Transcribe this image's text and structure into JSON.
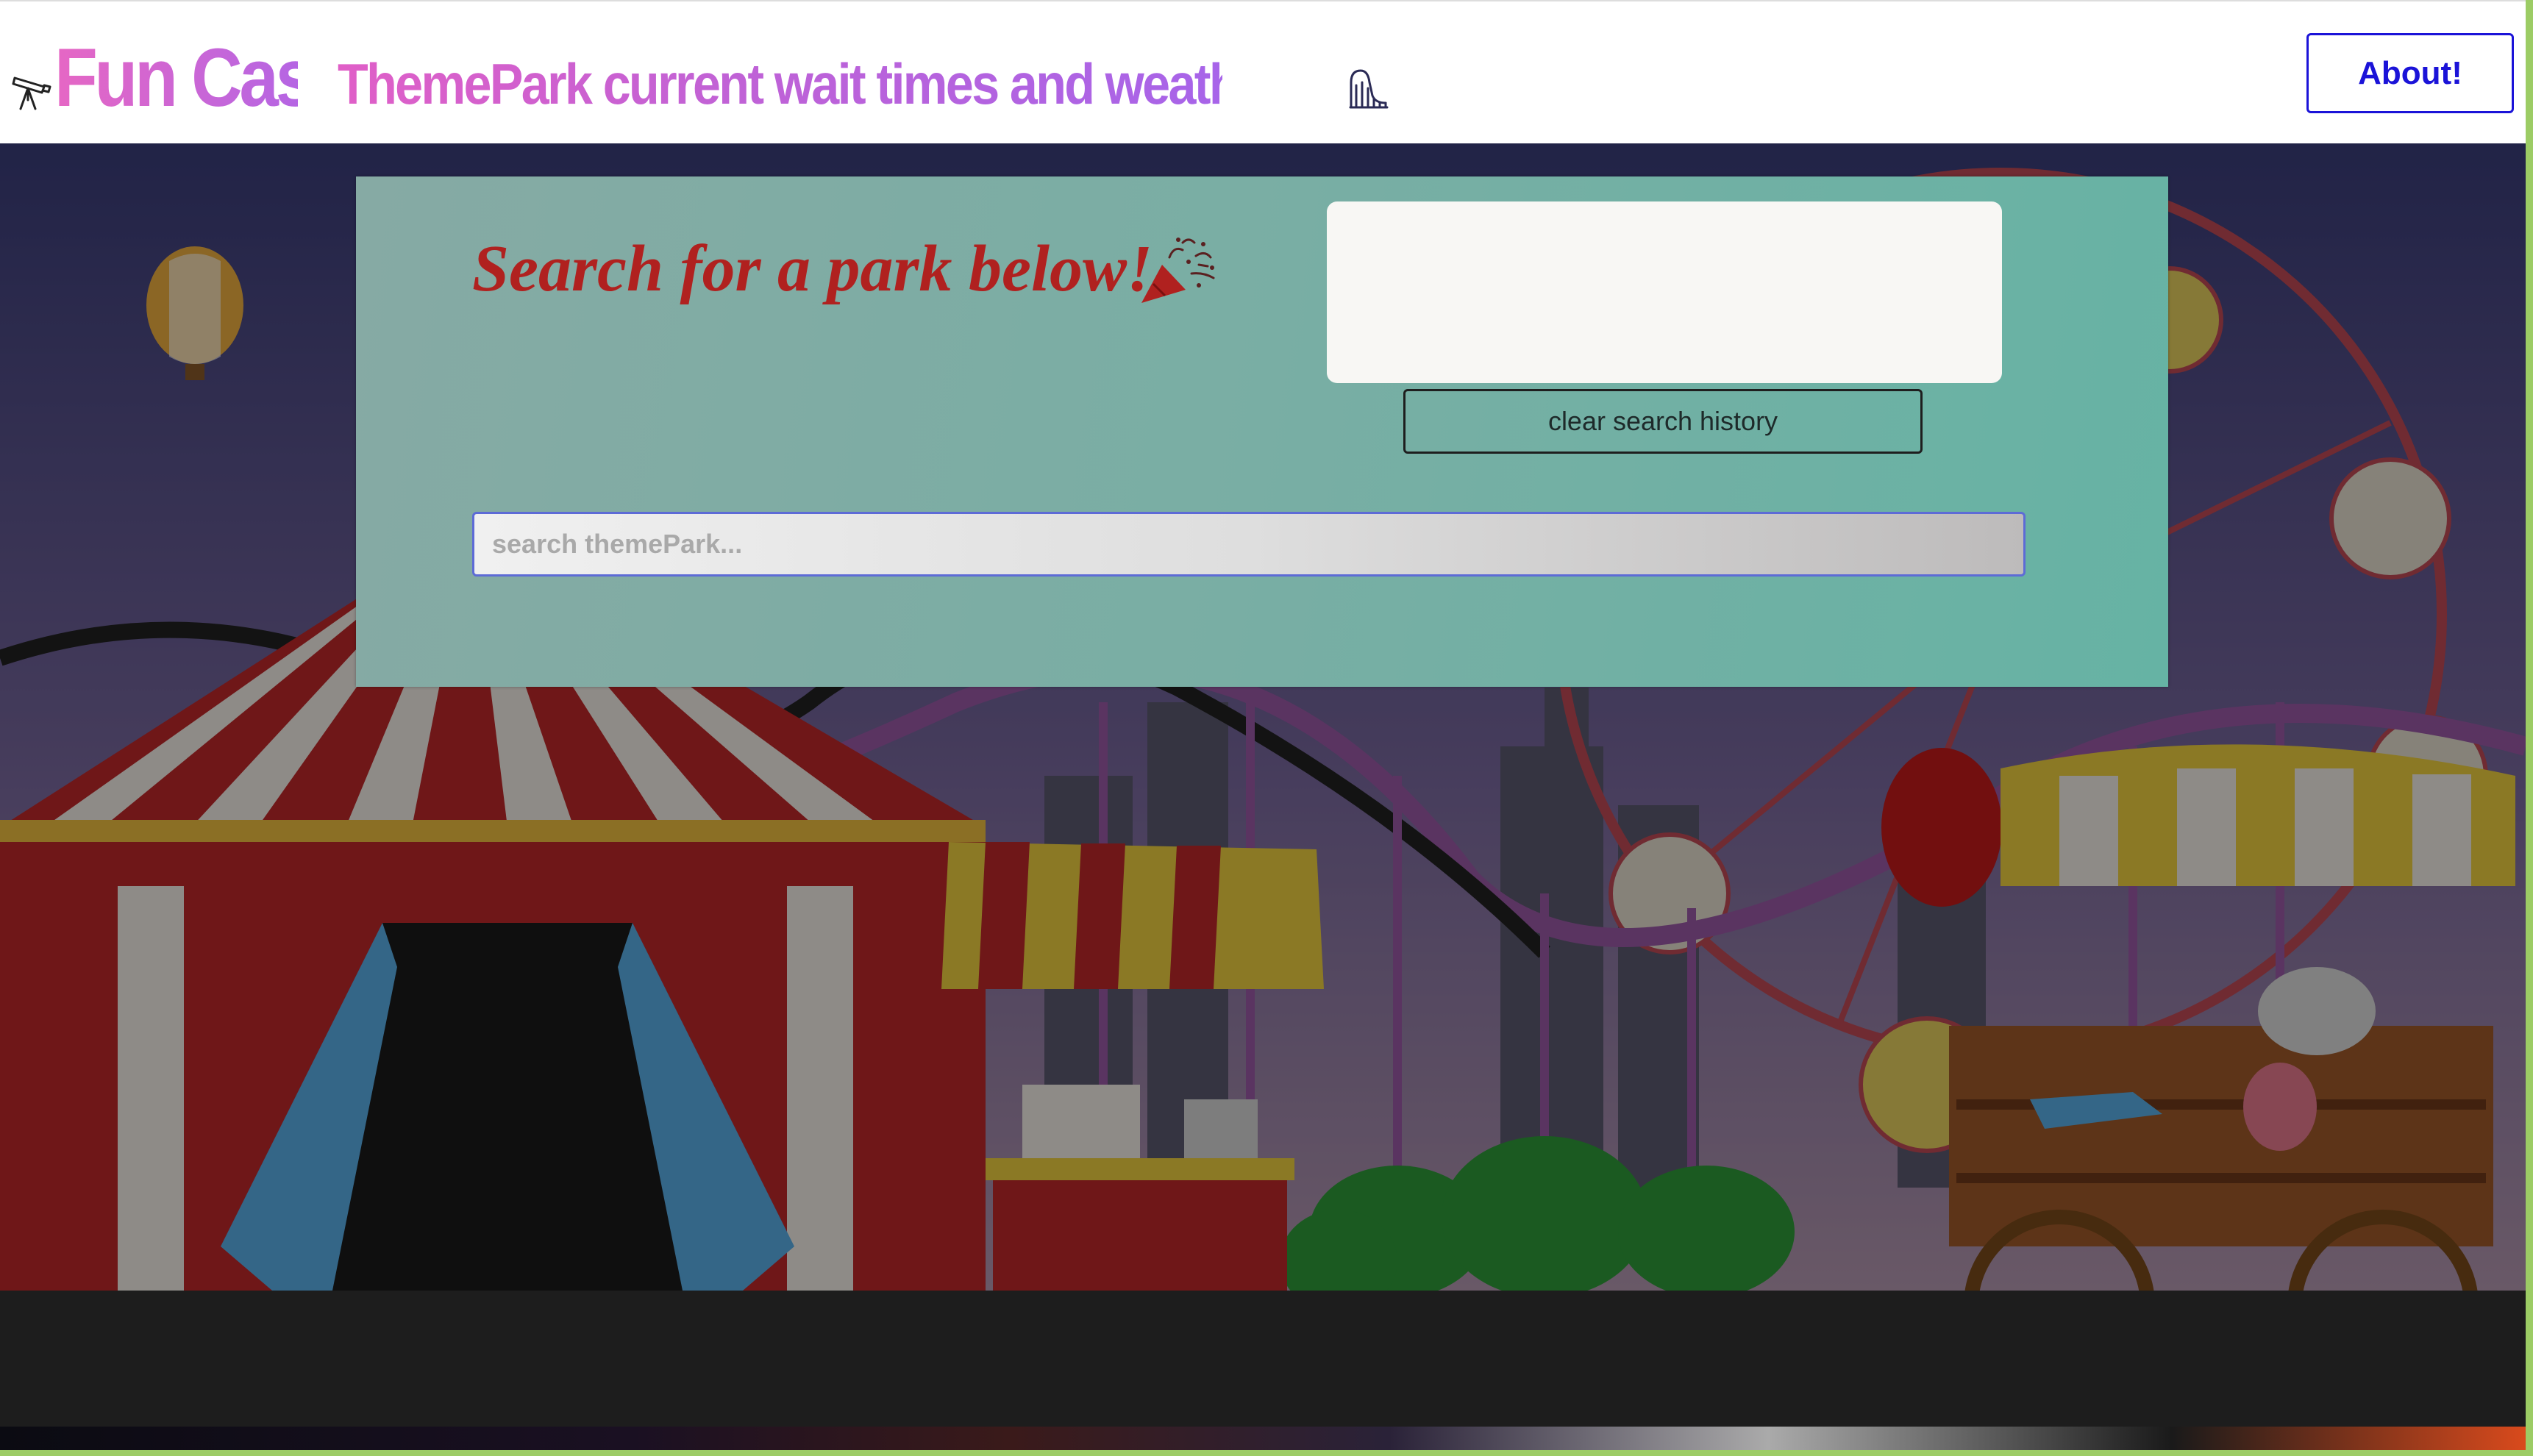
{
  "header": {
    "brand_name": "Fun Cast:",
    "tagline": "ThemePark current wait times and weather!",
    "left_icon": "telescope-icon",
    "right_icon": "roller-coaster-icon",
    "about_label": "About!"
  },
  "search_panel": {
    "heading": "Search for a park below!",
    "heading_icon": "party-popper-icon",
    "clear_history_label": "clear search history",
    "search_placeholder": "search themePark...",
    "search_value": ""
  },
  "colors": {
    "brand_gradient_start": "#e667c4",
    "brand_gradient_end": "#a764e9",
    "heading_red": "#b0211f",
    "about_blue": "#1b13d8",
    "panel_teal": "#79aea4"
  }
}
